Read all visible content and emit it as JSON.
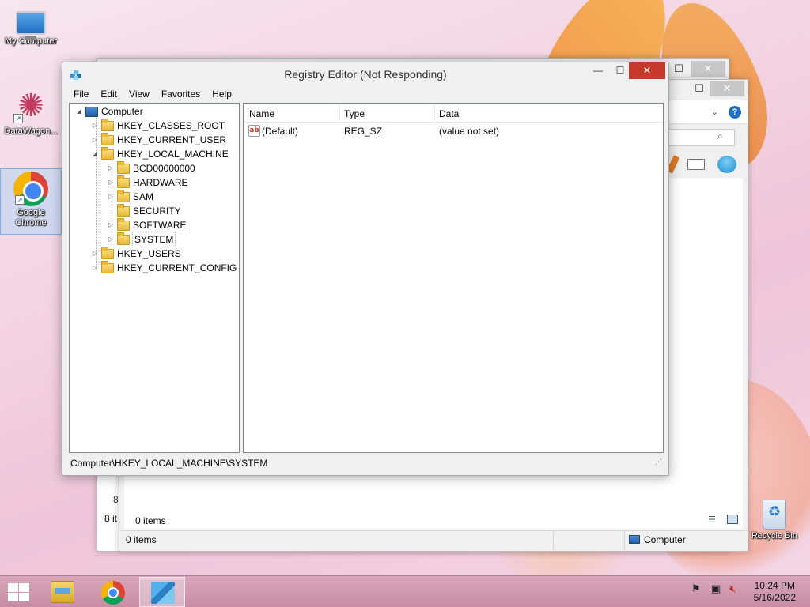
{
  "desktop": {
    "icons": [
      {
        "label": "My Computer"
      },
      {
        "label": "DataWagon..."
      },
      {
        "label": "Google Chrome"
      },
      {
        "label": "Recycle Bin"
      }
    ]
  },
  "background_windows": {
    "front_status_count": "0 items",
    "front_status_location": "Computer",
    "inner_status": "0 items",
    "back_status": "8 it",
    "back_partial": "8"
  },
  "regedit": {
    "title": "Registry Editor (Not Responding)",
    "menu": [
      "File",
      "Edit",
      "View",
      "Favorites",
      "Help"
    ],
    "tree": {
      "root": "Computer",
      "hives": [
        "HKEY_CLASSES_ROOT",
        "HKEY_CURRENT_USER",
        "HKEY_LOCAL_MACHINE"
      ],
      "hklm_children": [
        "BCD00000000",
        "HARDWARE",
        "SAM",
        "SECURITY",
        "SOFTWARE",
        "SYSTEM"
      ],
      "hives_after": [
        "HKEY_USERS",
        "HKEY_CURRENT_CONFIG"
      ]
    },
    "list": {
      "columns": [
        "Name",
        "Type",
        "Data"
      ],
      "rows": [
        {
          "name": "(Default)",
          "type": "REG_SZ",
          "data": "(value not set)",
          "icon": "string-value-icon"
        }
      ]
    },
    "status_path": "Computer\\HKEY_LOCAL_MACHINE\\SYSTEM"
  },
  "taskbar": {
    "clock_time": "10:24 PM",
    "clock_date": "5/16/2022",
    "items": [
      "file-explorer",
      "google-chrome",
      "registry-editor"
    ],
    "active_item": "registry-editor"
  },
  "colors": {
    "close_button": "#c7392b",
    "taskbar": "#c98da3",
    "selection": "#b4d7f5"
  }
}
